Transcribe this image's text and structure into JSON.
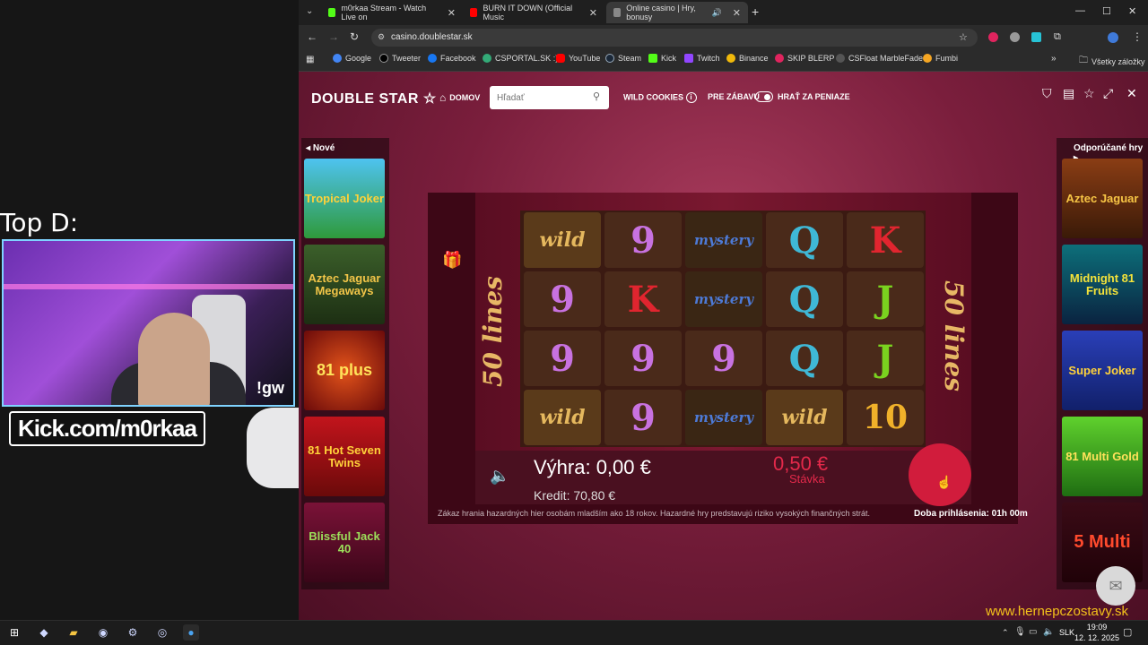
{
  "overlay": {
    "title": "Top D:",
    "cam_tag": "!gw",
    "kick_url": "Kick.com/m0rkaa"
  },
  "browser": {
    "tabs": [
      {
        "label": "m0rkaa Stream - Watch Live on",
        "color": "#53fc18"
      },
      {
        "label": "BURN IT DOWN (Official Music",
        "color": "#ff0000"
      },
      {
        "label": "Online casino | Hry, bonusy",
        "color": "#888888"
      }
    ],
    "new_tab": "+",
    "url": "casino.doublestar.sk",
    "bookmarks": [
      "Google",
      "Tweeter",
      "Facebook",
      "CSPORTAL.SK :)",
      "YouTube",
      "Steam",
      "Kick",
      "Twitch",
      "Binance",
      "SKIP BLERP",
      "CSFloat MarbleFade",
      "Fumbi"
    ],
    "all_bookmarks": "Všetky záložky"
  },
  "site": {
    "logo": "DOUBLE STAR",
    "nav_home": "DOMOV",
    "search_placeholder": "Hľadať",
    "wild_cookies": "WILD COOKIES",
    "mode_demo": "PRE ZÁBAVU",
    "mode_real": "HRAŤ ZA PENIAZE",
    "left_title": "Nové",
    "right_title": "Odporúčané hry",
    "left_games": [
      "Tropical Joker",
      "Aztec Jaguar Megaways",
      "81 plus",
      "81 Hot Seven Twins",
      "Blissful Jack 40"
    ],
    "right_games": [
      "Aztec Jaguar",
      "Midnight 81 Fruits",
      "Super Joker",
      "81 Multi Gold",
      "5 Multi"
    ],
    "disclaimer": "Zákaz hrania hazardných hier osobám mladším ako 18 rokov. Hazardné hry predstavujú riziko vysokých finančných strát.",
    "login_time": "Doba prihlásenia: 01h 00m",
    "watermark": "www.hernepczostavy.sk"
  },
  "game": {
    "lines_label": "50 lines",
    "reels": [
      [
        "wild",
        "9",
        "mystery",
        "Q",
        "K"
      ],
      [
        "9",
        "K",
        "mystery",
        "Q",
        "J"
      ],
      [
        "9",
        "9",
        "9",
        "Q",
        "J"
      ],
      [
        "wild",
        "9",
        "mystery",
        "wild",
        "10"
      ]
    ],
    "win_label": "Výhra: 0,00 €",
    "credit_label": "Kredit: 70,80 €",
    "stake_value": "0,50 €",
    "stake_label": "Stávka"
  },
  "taskbar": {
    "lang": "SLK",
    "time": "19:09",
    "date": "12. 12. 2025"
  }
}
